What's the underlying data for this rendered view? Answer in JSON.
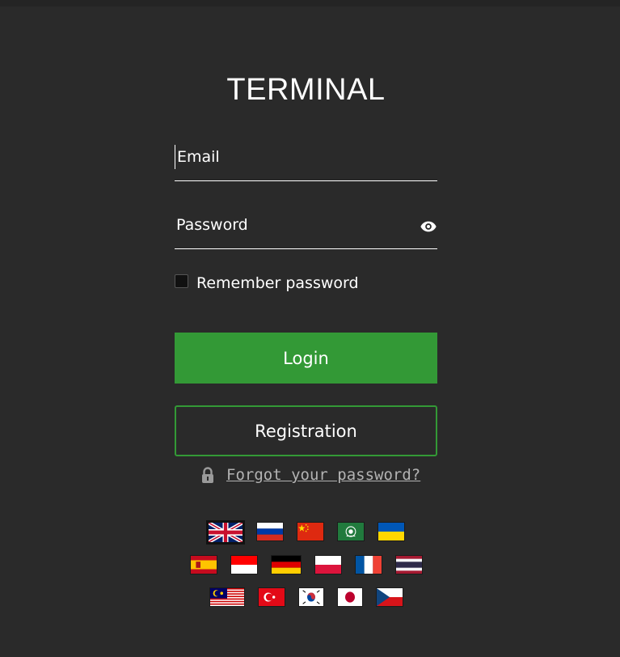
{
  "app": {
    "title": "TERMINAL"
  },
  "login_form": {
    "email_placeholder": "Email",
    "password_placeholder": "Password",
    "remember_label": "Remember password",
    "login_label": "Login",
    "registration_label": "Registration",
    "forgot_label": "Forgot your password?"
  },
  "colors": {
    "background": "#2a2a2a",
    "accent_green": "#339936",
    "link_gray": "#b3b3b3"
  },
  "languages": {
    "selected": "uk",
    "rows": [
      [
        "uk",
        "ru",
        "cn",
        "ar",
        "ua"
      ],
      [
        "es",
        "id",
        "de",
        "pl",
        "fr",
        "th"
      ],
      [
        "my",
        "tr",
        "kr",
        "jp",
        "cz"
      ]
    ]
  }
}
